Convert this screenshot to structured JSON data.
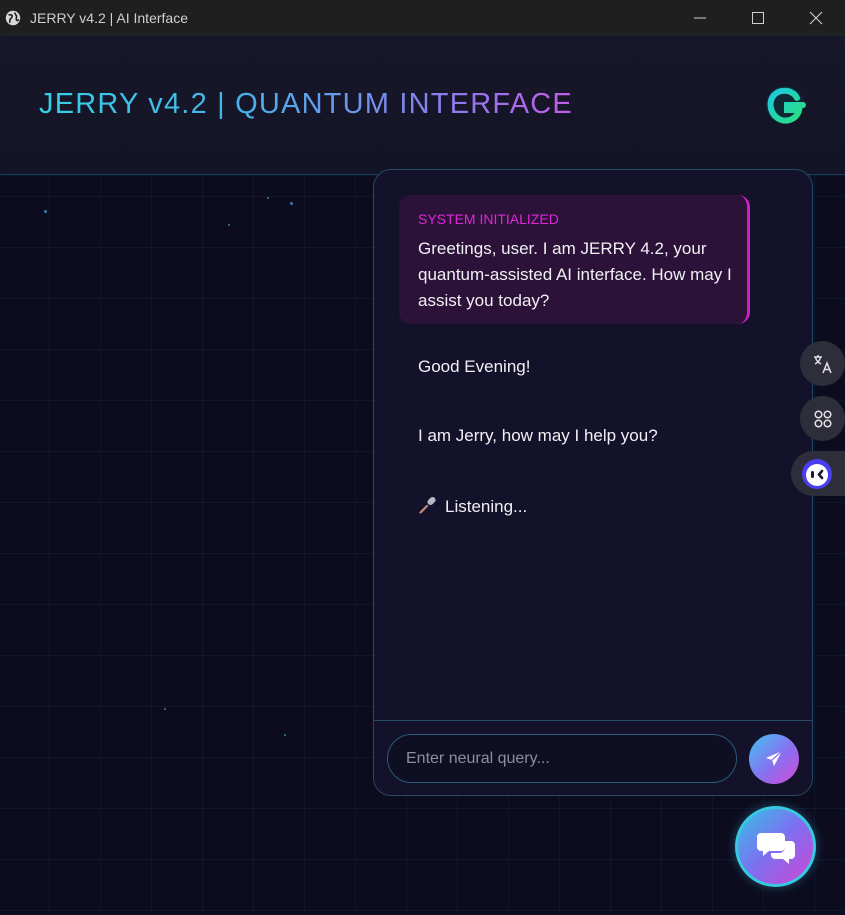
{
  "window": {
    "title": "JERRY v4.2 | AI Interface",
    "icon": "globe-icon",
    "controls": [
      "minimize-icon",
      "maximize-icon",
      "close-icon"
    ]
  },
  "header": {
    "title": "JERRY v4.2 | QUANTUM INTERFACE",
    "logo": "gradient-g-logo"
  },
  "chat": {
    "system_message": {
      "label": "SYSTEM INITIALIZED",
      "text": "Greetings, user. I am JERRY 4.2, your quantum-assisted AI interface. How may I assist you today?"
    },
    "messages": [
      {
        "text": "Good Evening!"
      },
      {
        "text": "I am Jerry, how may I help you?"
      }
    ],
    "status": {
      "icon": "microphone-icon",
      "text": "Listening..."
    },
    "input": {
      "placeholder": "Enter neural query...",
      "value": ""
    },
    "send_icon": "paper-plane-icon"
  },
  "side_buttons": [
    "translate-icon",
    "command-icon",
    "bot-assistant-icon"
  ],
  "fab_icon": "chat-bubbles-icon",
  "colors": {
    "background": "#0c0b1d",
    "accent_cyan": "#33d1e6",
    "accent_magenta": "#d11fc7",
    "panel": "#13122a",
    "system_bubble": "#2c1238"
  }
}
